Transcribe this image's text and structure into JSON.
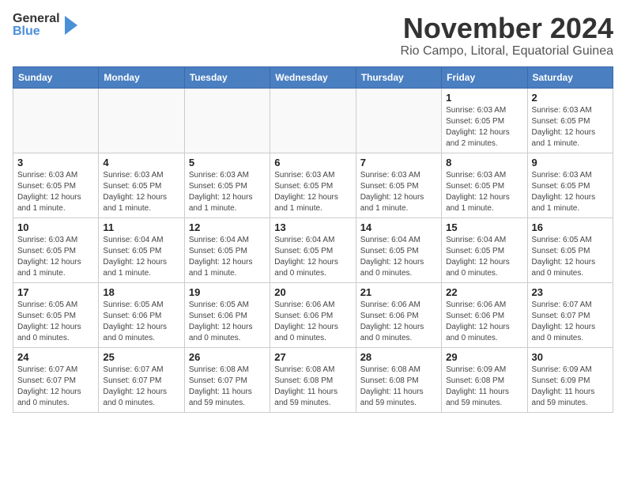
{
  "header": {
    "logo_line1": "General",
    "logo_line2": "Blue",
    "month_year": "November 2024",
    "location": "Rio Campo, Litoral, Equatorial Guinea"
  },
  "weekdays": [
    "Sunday",
    "Monday",
    "Tuesday",
    "Wednesday",
    "Thursday",
    "Friday",
    "Saturday"
  ],
  "weeks": [
    [
      {
        "day": "",
        "info": ""
      },
      {
        "day": "",
        "info": ""
      },
      {
        "day": "",
        "info": ""
      },
      {
        "day": "",
        "info": ""
      },
      {
        "day": "",
        "info": ""
      },
      {
        "day": "1",
        "info": "Sunrise: 6:03 AM\nSunset: 6:05 PM\nDaylight: 12 hours and 2 minutes."
      },
      {
        "day": "2",
        "info": "Sunrise: 6:03 AM\nSunset: 6:05 PM\nDaylight: 12 hours and 1 minute."
      }
    ],
    [
      {
        "day": "3",
        "info": "Sunrise: 6:03 AM\nSunset: 6:05 PM\nDaylight: 12 hours and 1 minute."
      },
      {
        "day": "4",
        "info": "Sunrise: 6:03 AM\nSunset: 6:05 PM\nDaylight: 12 hours and 1 minute."
      },
      {
        "day": "5",
        "info": "Sunrise: 6:03 AM\nSunset: 6:05 PM\nDaylight: 12 hours and 1 minute."
      },
      {
        "day": "6",
        "info": "Sunrise: 6:03 AM\nSunset: 6:05 PM\nDaylight: 12 hours and 1 minute."
      },
      {
        "day": "7",
        "info": "Sunrise: 6:03 AM\nSunset: 6:05 PM\nDaylight: 12 hours and 1 minute."
      },
      {
        "day": "8",
        "info": "Sunrise: 6:03 AM\nSunset: 6:05 PM\nDaylight: 12 hours and 1 minute."
      },
      {
        "day": "9",
        "info": "Sunrise: 6:03 AM\nSunset: 6:05 PM\nDaylight: 12 hours and 1 minute."
      }
    ],
    [
      {
        "day": "10",
        "info": "Sunrise: 6:03 AM\nSunset: 6:05 PM\nDaylight: 12 hours and 1 minute."
      },
      {
        "day": "11",
        "info": "Sunrise: 6:04 AM\nSunset: 6:05 PM\nDaylight: 12 hours and 1 minute."
      },
      {
        "day": "12",
        "info": "Sunrise: 6:04 AM\nSunset: 6:05 PM\nDaylight: 12 hours and 1 minute."
      },
      {
        "day": "13",
        "info": "Sunrise: 6:04 AM\nSunset: 6:05 PM\nDaylight: 12 hours and 0 minutes."
      },
      {
        "day": "14",
        "info": "Sunrise: 6:04 AM\nSunset: 6:05 PM\nDaylight: 12 hours and 0 minutes."
      },
      {
        "day": "15",
        "info": "Sunrise: 6:04 AM\nSunset: 6:05 PM\nDaylight: 12 hours and 0 minutes."
      },
      {
        "day": "16",
        "info": "Sunrise: 6:05 AM\nSunset: 6:05 PM\nDaylight: 12 hours and 0 minutes."
      }
    ],
    [
      {
        "day": "17",
        "info": "Sunrise: 6:05 AM\nSunset: 6:05 PM\nDaylight: 12 hours and 0 minutes."
      },
      {
        "day": "18",
        "info": "Sunrise: 6:05 AM\nSunset: 6:06 PM\nDaylight: 12 hours and 0 minutes."
      },
      {
        "day": "19",
        "info": "Sunrise: 6:05 AM\nSunset: 6:06 PM\nDaylight: 12 hours and 0 minutes."
      },
      {
        "day": "20",
        "info": "Sunrise: 6:06 AM\nSunset: 6:06 PM\nDaylight: 12 hours and 0 minutes."
      },
      {
        "day": "21",
        "info": "Sunrise: 6:06 AM\nSunset: 6:06 PM\nDaylight: 12 hours and 0 minutes."
      },
      {
        "day": "22",
        "info": "Sunrise: 6:06 AM\nSunset: 6:06 PM\nDaylight: 12 hours and 0 minutes."
      },
      {
        "day": "23",
        "info": "Sunrise: 6:07 AM\nSunset: 6:07 PM\nDaylight: 12 hours and 0 minutes."
      }
    ],
    [
      {
        "day": "24",
        "info": "Sunrise: 6:07 AM\nSunset: 6:07 PM\nDaylight: 12 hours and 0 minutes."
      },
      {
        "day": "25",
        "info": "Sunrise: 6:07 AM\nSunset: 6:07 PM\nDaylight: 12 hours and 0 minutes."
      },
      {
        "day": "26",
        "info": "Sunrise: 6:08 AM\nSunset: 6:07 PM\nDaylight: 11 hours and 59 minutes."
      },
      {
        "day": "27",
        "info": "Sunrise: 6:08 AM\nSunset: 6:08 PM\nDaylight: 11 hours and 59 minutes."
      },
      {
        "day": "28",
        "info": "Sunrise: 6:08 AM\nSunset: 6:08 PM\nDaylight: 11 hours and 59 minutes."
      },
      {
        "day": "29",
        "info": "Sunrise: 6:09 AM\nSunset: 6:08 PM\nDaylight: 11 hours and 59 minutes."
      },
      {
        "day": "30",
        "info": "Sunrise: 6:09 AM\nSunset: 6:09 PM\nDaylight: 11 hours and 59 minutes."
      }
    ]
  ]
}
